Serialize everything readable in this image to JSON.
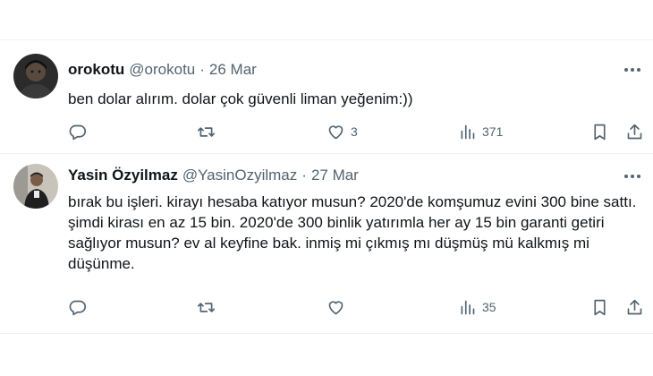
{
  "tweets": [
    {
      "name": "orokotu",
      "handle": "@orokotu",
      "separator": "·",
      "date": "26 Mar",
      "text": "ben dolar alırım. dolar çok güvenli liman yeğenim:))",
      "stats": {
        "replies": "",
        "retweets": "",
        "likes": "3",
        "views": "371"
      }
    },
    {
      "name": "Yasin Özyilmaz",
      "handle": "@YasinOzyilmaz",
      "separator": "·",
      "date": "27 Mar",
      "text": "bırak bu işleri. kirayı hesaba katıyor musun? 2020'de komşumuz evini 300 bine sattı. şimdi kirası en az 15 bin. 2020'de 300 binlik yatırımla her ay 15 bin garanti getiri sağlıyor musun? ev al keyfine bak. inmiş mi çıkmış mı düşmüş mü kalkmış mi düşünme.",
      "stats": {
        "replies": "",
        "retweets": "",
        "likes": "",
        "views": "35"
      }
    }
  ],
  "icons": {
    "more": "more-horizontal-icon",
    "reply": "reply-icon",
    "retweet": "retweet-icon",
    "like": "heart-icon",
    "views": "views-icon",
    "bookmark": "bookmark-icon",
    "share": "share-icon"
  },
  "colors": {
    "text": "#0f1419",
    "secondary": "#536471",
    "divider": "#eff3f4",
    "background": "#ffffff"
  }
}
